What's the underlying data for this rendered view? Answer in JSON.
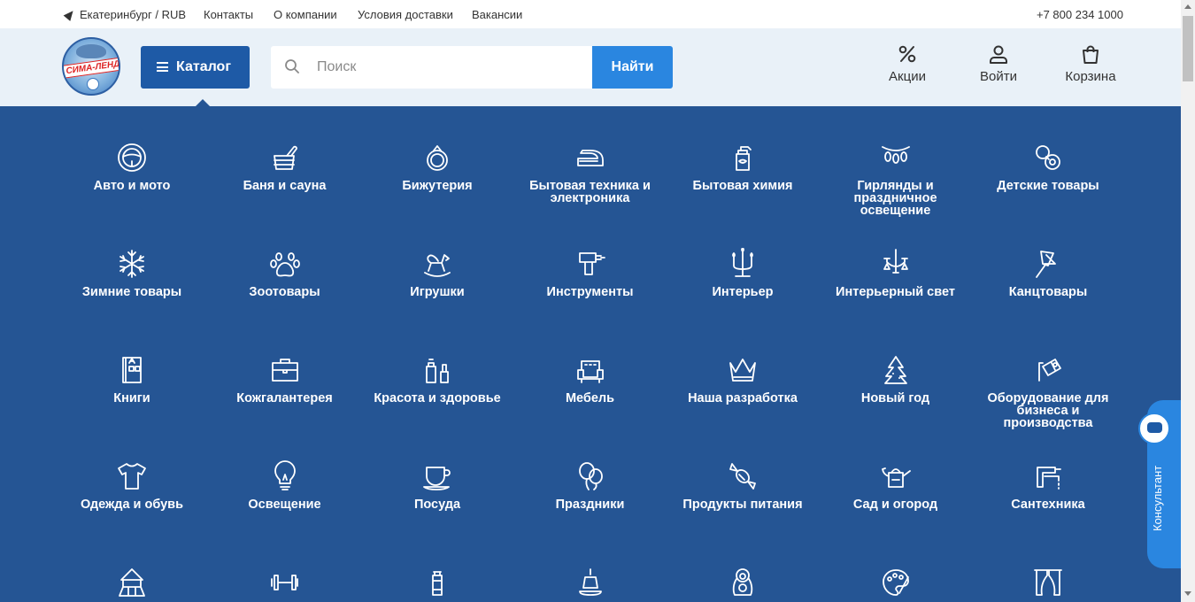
{
  "topbar": {
    "location": "Екатеринбург / RUB",
    "links": [
      "Контакты",
      "О компании",
      "Условия доставки",
      "Вакансии"
    ],
    "phone": "+7 800 234 1000"
  },
  "header": {
    "logo_text": "СИМА-ЛЕНД",
    "catalog_label": "Каталог",
    "search_placeholder": "Поиск",
    "find_label": "Найти",
    "actions": {
      "promo": "Акции",
      "login": "Войти",
      "cart": "Корзина"
    }
  },
  "categories": [
    {
      "name": "Авто и мото",
      "icon": "steering-wheel-icon"
    },
    {
      "name": "Баня и сауна",
      "icon": "sauna-bucket-icon"
    },
    {
      "name": "Бижутерия",
      "icon": "ring-icon"
    },
    {
      "name": "Бытовая техника и электроника",
      "icon": "iron-icon"
    },
    {
      "name": "Бытовая химия",
      "icon": "spray-bottle-icon"
    },
    {
      "name": "Гирлянды и праздничное освещение",
      "icon": "garland-icon"
    },
    {
      "name": "Детские товары",
      "icon": "pacifier-icon"
    },
    {
      "name": "Зимние товары",
      "icon": "snowflake-icon"
    },
    {
      "name": "Зоотовары",
      "icon": "paw-icon"
    },
    {
      "name": "Игрушки",
      "icon": "rocking-horse-icon"
    },
    {
      "name": "Инструменты",
      "icon": "drill-icon"
    },
    {
      "name": "Интерьер",
      "icon": "candelabra-icon"
    },
    {
      "name": "Интерьерный свет",
      "icon": "chandelier-icon"
    },
    {
      "name": "Канцтовары",
      "icon": "pushpin-icon"
    },
    {
      "name": "Книги",
      "icon": "book-icon"
    },
    {
      "name": "Кожгалантерея",
      "icon": "briefcase-icon"
    },
    {
      "name": "Красота и здоровье",
      "icon": "cosmetics-icon"
    },
    {
      "name": "Мебель",
      "icon": "armchair-icon"
    },
    {
      "name": "Наша разработка",
      "icon": "crown-icon"
    },
    {
      "name": "Новый год",
      "icon": "christmas-tree-icon"
    },
    {
      "name": "Оборудование для бизнеса и производства",
      "icon": "camera-icon"
    },
    {
      "name": "Одежда и обувь",
      "icon": "tshirt-icon"
    },
    {
      "name": "Освещение",
      "icon": "lightbulb-icon"
    },
    {
      "name": "Посуда",
      "icon": "cup-icon"
    },
    {
      "name": "Праздники",
      "icon": "balloons-icon"
    },
    {
      "name": "Продукты питания",
      "icon": "candy-icon"
    },
    {
      "name": "Сад и огород",
      "icon": "watering-can-icon"
    },
    {
      "name": "Сантехника",
      "icon": "faucet-icon"
    },
    {
      "name": "",
      "icon": "playground-icon"
    },
    {
      "name": "",
      "icon": "dumbbell-icon"
    },
    {
      "name": "",
      "icon": "bottle-icon"
    },
    {
      "name": "",
      "icon": "bell-icon"
    },
    {
      "name": "",
      "icon": "matryoshka-icon"
    },
    {
      "name": "",
      "icon": "palette-icon"
    },
    {
      "name": "",
      "icon": "curtains-icon"
    }
  ],
  "consultant_label": "Консультант",
  "colors": {
    "catalog_bg": "#255594",
    "accent": "#2a86e0",
    "catalog_button": "#1e5aa6",
    "header_bg": "#e9f1f8"
  }
}
